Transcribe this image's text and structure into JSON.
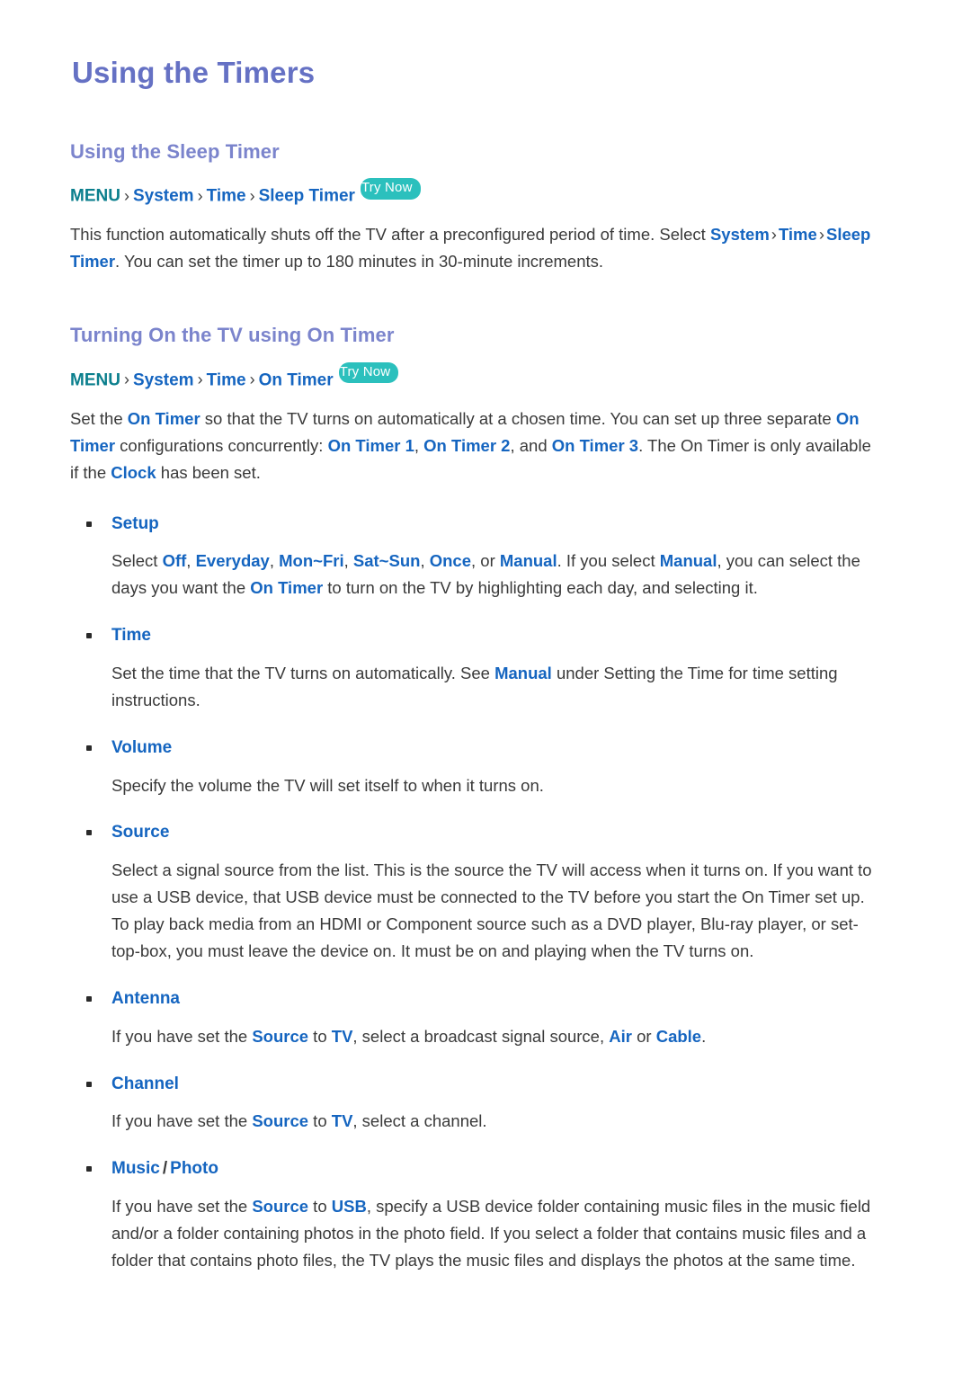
{
  "page": {
    "title": "Using the Timers"
  },
  "colors": {
    "title": "#6571c4",
    "section_heading": "#7b84cc",
    "keyword_blue": "#1565c0",
    "menu_root_teal": "#0b7f8d",
    "try_now_badge": "#2bc0bd",
    "body_text": "#3a3a3a",
    "background": "#ffffff"
  },
  "sections": [
    {
      "heading": "Using the Sleep Timer",
      "menu_path": {
        "root": "MENU",
        "separator": "›",
        "items": [
          "System",
          "Time",
          "Sleep Timer"
        ],
        "badge": "Try Now"
      },
      "paragraph": {
        "part1": "This function automatically shuts off the TV after a preconfigured period of time. Select ",
        "kw1": "System",
        "sep1": "›",
        "kw2": "Time",
        "sep2": "›",
        "kw3": "Sleep Timer",
        "part2": ". You can set the timer up to 180 minutes in 30-minute increments."
      }
    },
    {
      "heading": "Turning On the TV using On Timer",
      "menu_path": {
        "root": "MENU",
        "separator": "›",
        "items": [
          "System",
          "Time",
          "On Timer"
        ],
        "badge": "Try Now"
      },
      "paragraph": {
        "part1": "Set the ",
        "kw1": "On Timer",
        "part2": " so that the TV turns on automatically at a chosen time. You can set up three separate ",
        "kw2": "On Timer",
        "part3": " configurations concurrently: ",
        "kw3": "On Timer 1",
        "part4": ", ",
        "kw4": "On Timer 2",
        "part5": ", and ",
        "kw5": "On Timer 3",
        "part6": ". The On Timer is only available if the ",
        "kw6": "Clock",
        "part7": " has been set."
      }
    }
  ],
  "bullets": [
    {
      "label": "Setup",
      "body": {
        "part1": "Select ",
        "kw1": "Off",
        "part2": ", ",
        "kw2": "Everyday",
        "part3": ", ",
        "kw3": "Mon~Fri",
        "part4": ", ",
        "kw4": "Sat~Sun",
        "part5": ", ",
        "kw5": "Once",
        "part6": ", or ",
        "kw6": "Manual",
        "part7": ". If you select ",
        "kw7": "Manual",
        "part8": ", you can select the days you want the ",
        "kw8": "On Timer",
        "part9": " to turn on the TV by highlighting each day, and selecting it."
      }
    },
    {
      "label": "Time",
      "body": {
        "part1": "Set the time that the TV turns on automatically. See ",
        "kw1": "Manual",
        "part2": " under Setting the Time for time setting instructions."
      }
    },
    {
      "label": "Volume",
      "body": {
        "part1": "Specify the volume the TV will set itself to when it turns on."
      }
    },
    {
      "label": "Source",
      "body": {
        "part1": "Select a signal source from the list. This is the source the TV will access when it turns on. If you want to use a USB device, that USB device must be connected to the TV before you start the On Timer set up. To play back media from an HDMI or Component source such as a DVD player, Blu-ray player, or set-top-box, you must leave the device on. It must be on and playing when the TV turns on."
      }
    },
    {
      "label": "Antenna",
      "body": {
        "part1": "If you have set the ",
        "kw1": "Source",
        "part2": " to ",
        "kw2": "TV",
        "part3": ", select a broadcast signal source, ",
        "kw3": "Air",
        "part4": " or ",
        "kw4": "Cable",
        "part5": "."
      }
    },
    {
      "label": "Channel",
      "body": {
        "part1": "If you have set the ",
        "kw1": "Source",
        "part2": " to ",
        "kw2": "TV",
        "part3": ", select a channel."
      }
    },
    {
      "label_music": "Music",
      "label_slash": "/",
      "label_photo": "Photo",
      "body": {
        "part1": "If you have set the ",
        "kw1": "Source",
        "part2": " to ",
        "kw2": "USB",
        "part3": ", specify a USB device folder containing music files in the music field and/or a folder containing photos in the photo field. If you select a folder that contains music files and a folder that contains photo files, the TV plays the music files and displays the photos at the same time."
      }
    }
  ]
}
